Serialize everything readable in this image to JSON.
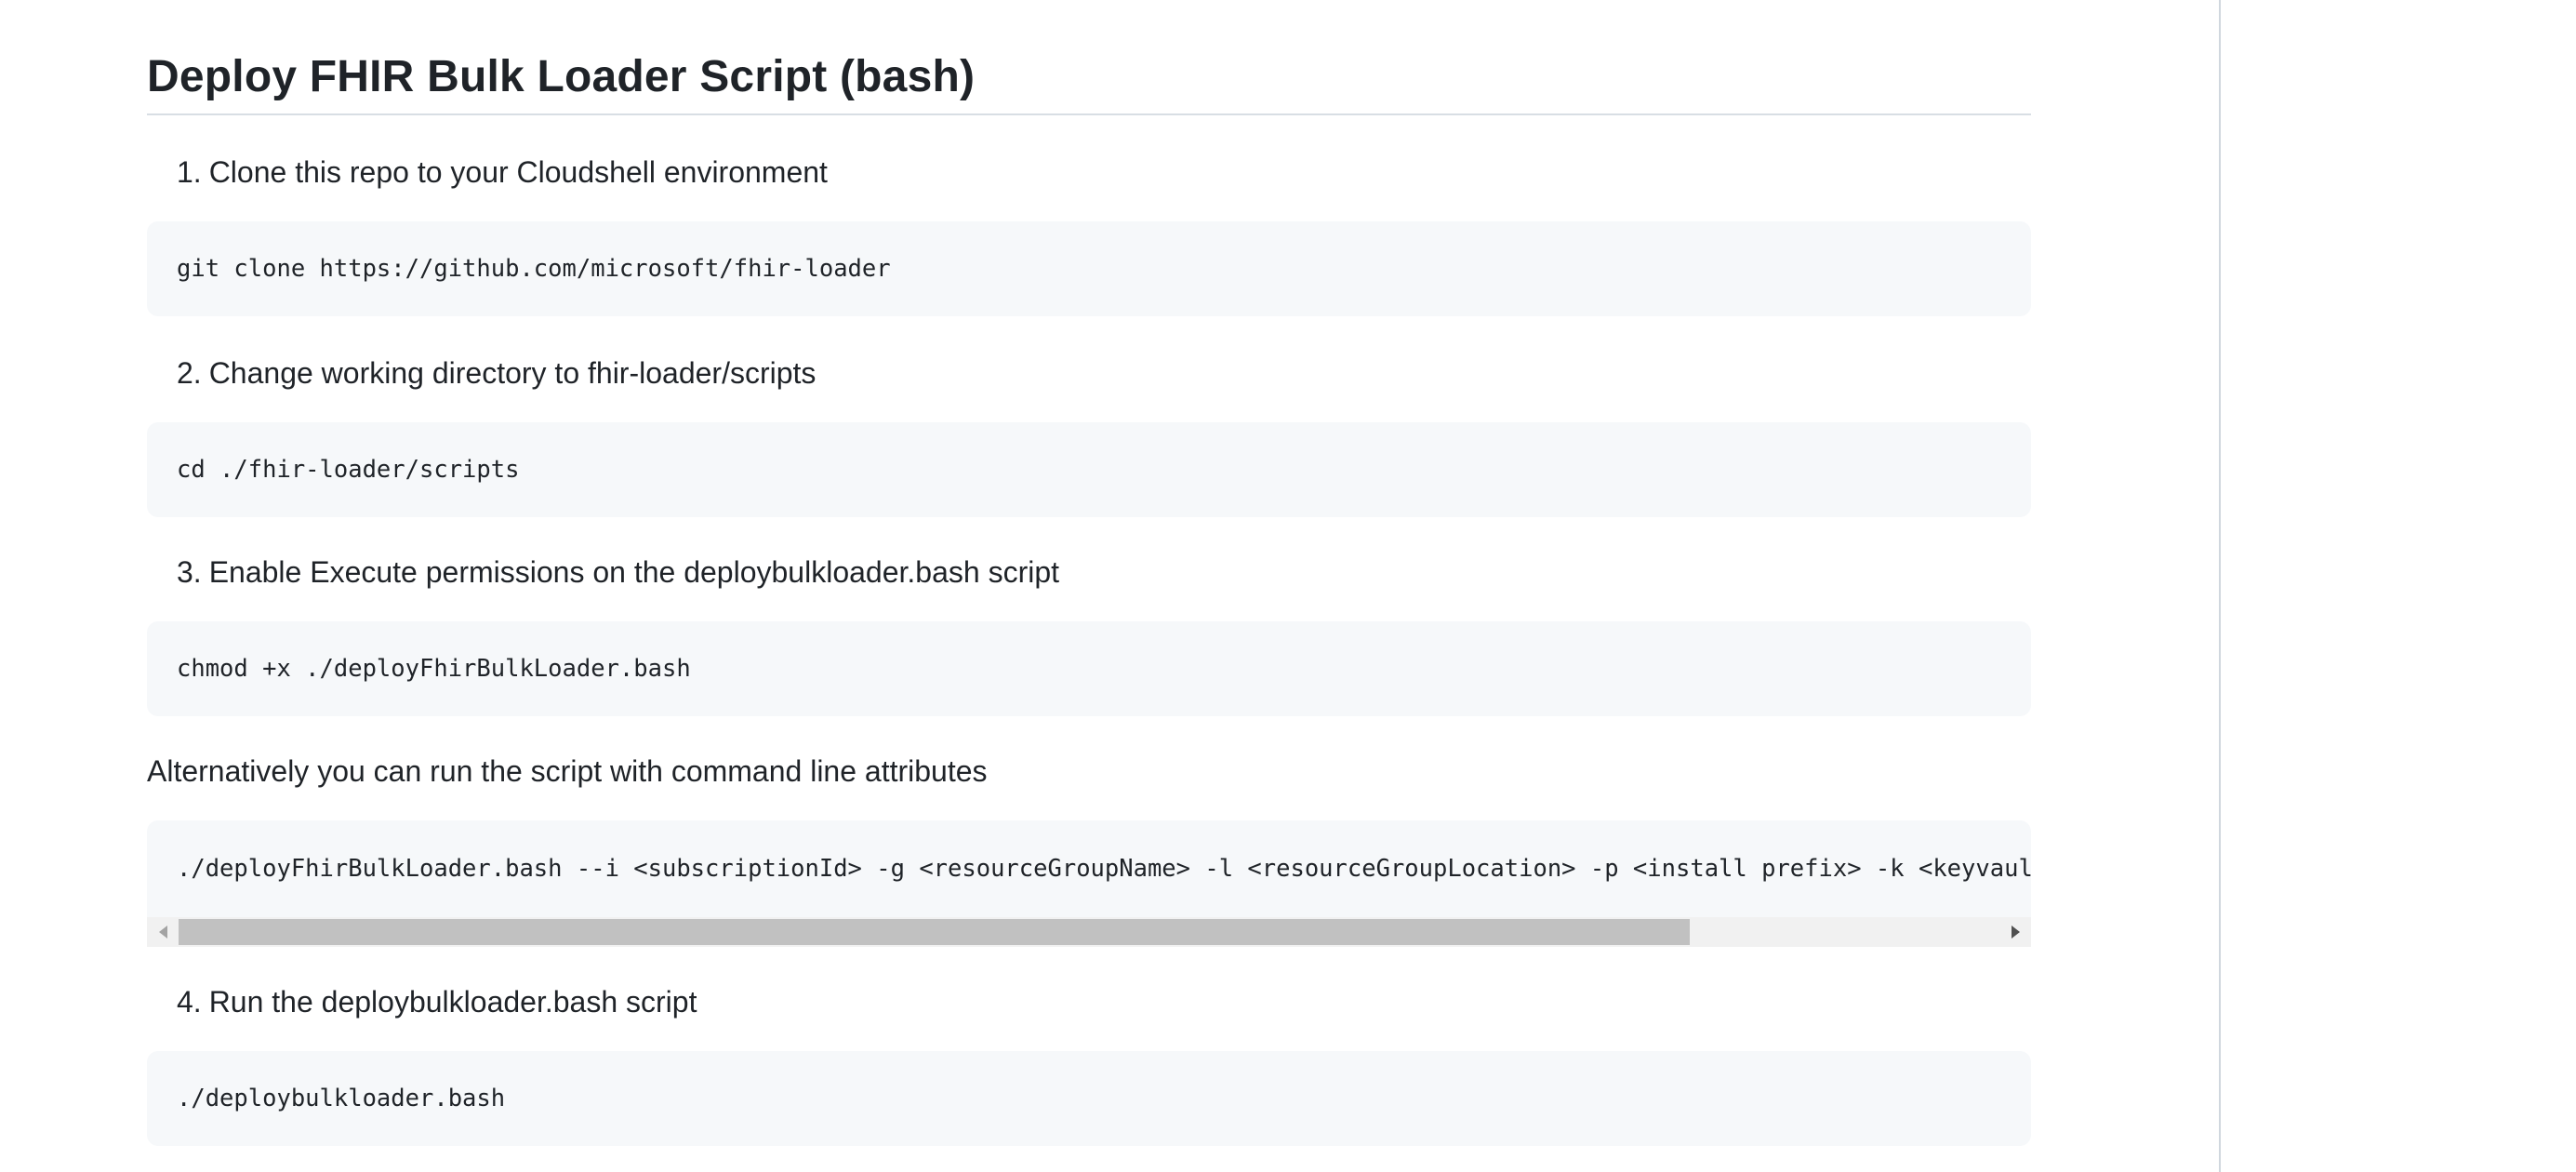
{
  "heading": "Deploy FHIR Bulk Loader Script (bash)",
  "steps": [
    {
      "number": "1.",
      "text": "Clone this repo to your Cloudshell environment",
      "code": "git clone https://github.com/microsoft/fhir-loader"
    },
    {
      "number": "2.",
      "text": "Change working directory to fhir-loader/scripts",
      "code": "cd ./fhir-loader/scripts"
    },
    {
      "number": "3.",
      "text": "Enable Execute permissions on the deploybulkloader.bash script",
      "code": "chmod +x ./deployFhirBulkLoader.bash"
    },
    {
      "number": "4.",
      "text": "Run the deploybulkloader.bash script",
      "code": "./deploybulkloader.bash"
    }
  ],
  "alternative": {
    "text": "Alternatively you can run the script with command line attributes",
    "code": "./deployFhirBulkLoader.bash --i <subscriptionId> -g <resourceGroupName> -l <resourceGroupLocation> -p <install prefix> -k <keyvault>"
  },
  "scrollbar": {
    "position_fraction": 0.0,
    "visible_fraction": 0.83,
    "left_arrow_icon": "triangle-left-icon",
    "right_arrow_icon": "triangle-right-icon"
  },
  "colors": {
    "code_background": "#f6f8fa",
    "text": "#1f2328",
    "divider": "#d0d7de"
  }
}
